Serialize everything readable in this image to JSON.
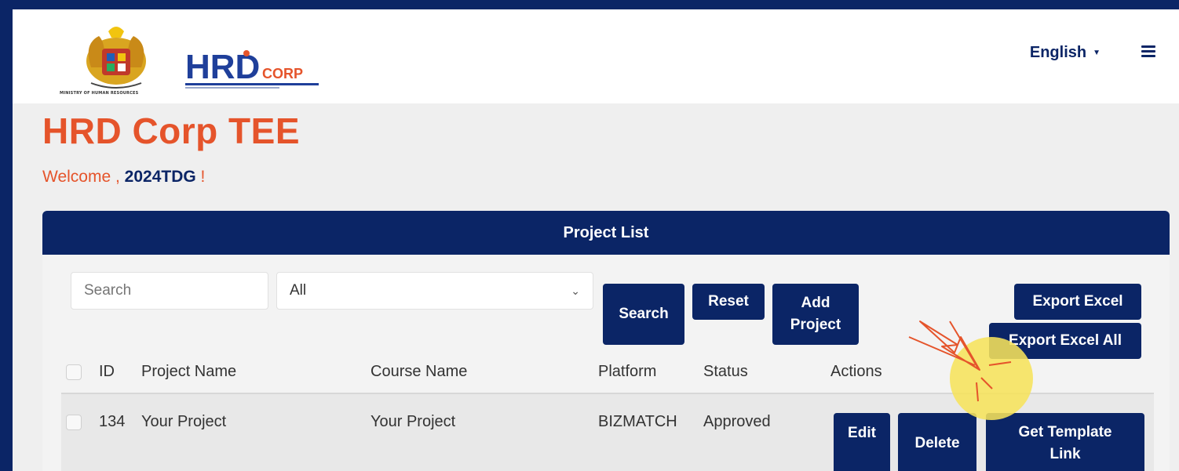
{
  "header": {
    "ministry_text": "MINISTRY OF HUMAN RESOURCES",
    "brand_main": "HRD",
    "brand_sub": "CORP",
    "language": "English"
  },
  "page": {
    "title": "HRD Corp TEE",
    "welcome_prefix": "Welcome , ",
    "username": "2024TDG",
    "welcome_suffix": " !"
  },
  "panel": {
    "title": "Project List",
    "search_placeholder": "Search",
    "filter_value": "All",
    "buttons": {
      "search": "Search",
      "reset": "Reset",
      "add_project": "Add Project",
      "export_excel": "Export Excel",
      "export_excel_all": "Export Excel All"
    }
  },
  "table": {
    "columns": [
      "ID",
      "Project Name",
      "Course Name",
      "Platform",
      "Status",
      "Actions"
    ],
    "rows": [
      {
        "id": "134",
        "project_name": "Your Project",
        "course_name": "Your Project",
        "platform": "BIZMATCH",
        "status": "Approved",
        "actions": [
          "Edit",
          "Delete",
          "Get Template Link"
        ]
      }
    ]
  },
  "colors": {
    "navy": "#0b2566",
    "accent_orange": "#e5542b",
    "highlight_yellow": "#f6e25b"
  },
  "icons": [
    "crest-logo-icon",
    "hrd-corp-logo-icon",
    "caret-down-icon",
    "hamburger-menu-icon",
    "chevron-down-icon",
    "checkbox-icon",
    "click-cursor-icon"
  ]
}
